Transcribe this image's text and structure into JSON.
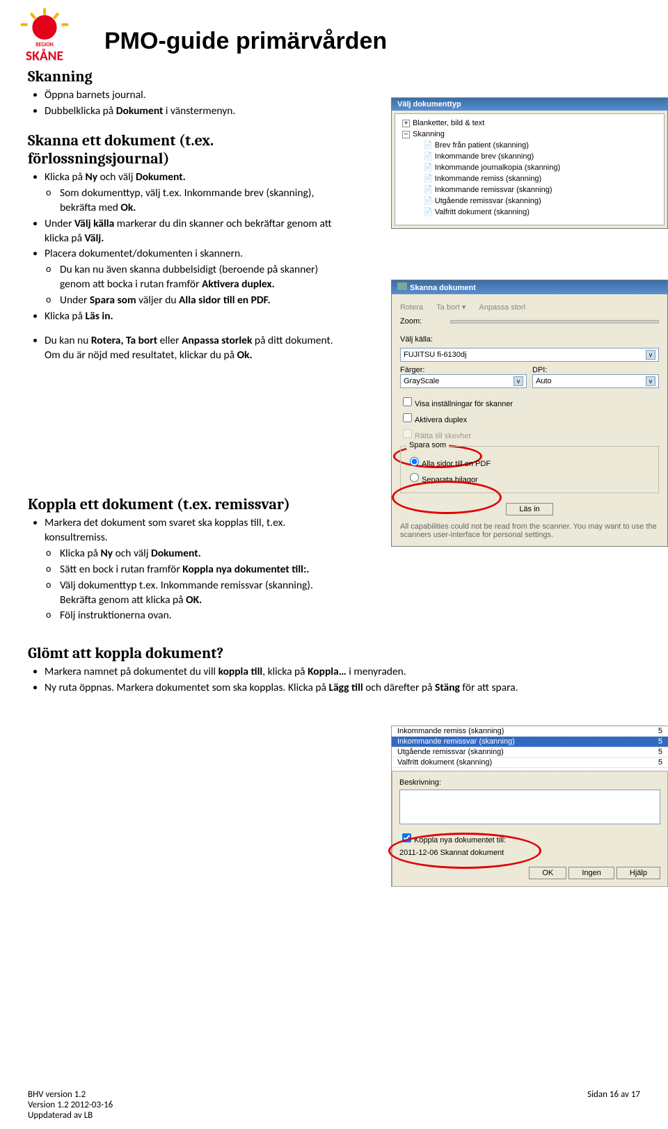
{
  "header": {
    "title": "PMO-guide primärvården",
    "brand_top": "REGION",
    "brand": "SKÅNE"
  },
  "s1": {
    "title": "Skanning",
    "b_pre": "Öppna barnets journal.",
    "b_dbla": "Dubbelklicka på ",
    "b_dblb": "Dokument",
    "b_dblc": " i vänstermenyn."
  },
  "s2": {
    "title": "Skanna ett dokument (t.ex. förlossningsjournal)",
    "l1a": "Klicka på ",
    "l1b": "Ny",
    "l1c": " och välj ",
    "l1d": "Dokument.",
    "o1a": "Som dokumenttyp, välj t.ex. Inkommande brev (skanning), bekräfta med ",
    "o1b": "Ok.",
    "l2a": "Under ",
    "l2b": "Välj källa",
    "l2c": " markerar du din skanner och bekräftar genom att klicka på ",
    "l2d": "Välj.",
    "l3": "Placera dokumentet/dokumenten i skannern.",
    "o2a": "Du kan nu även skanna dubbelsidigt (beroende på skanner) genom att bocka i rutan framför ",
    "o2b": "Aktivera duplex.",
    "o3a": "Under ",
    "o3b": "Spara som",
    "o3c": " väljer du ",
    "o3d": "Alla sidor till en PDF.",
    "l4a": "Klicka på ",
    "l4b": "Läs in.",
    "l5a": "Du kan nu ",
    "l5b": "Rotera, Ta bort",
    "l5c": " eller ",
    "l5d": "Anpassa storlek",
    "l5e": " på ditt dokument. Om du är nöjd med resultatet, klickar du på ",
    "l5f": "Ok."
  },
  "s3": {
    "title": "Koppla ett dokument (t.ex. remissvar)",
    "l1": "Markera det dokument som svaret ska kopplas till, t.ex. konsultremiss.",
    "o1a": "Klicka på ",
    "o1b": "Ny",
    "o1c": " och välj ",
    "o1d": "Dokument.",
    "o2a": "Sätt en bock i rutan framför ",
    "o2b": "Koppla nya dokumentet till:.",
    "o3a": "Välj dokumenttyp t.ex. Inkommande remissvar (skanning). Bekräfta genom att klicka på ",
    "o3b": "OK.",
    "o4": "Följ instruktionerna ovan."
  },
  "s4": {
    "title": "Glömt att koppla dokument?",
    "l1a": "Markera namnet på dokumentet du vill ",
    "l1b": "koppla till",
    "l1c": ", klicka på ",
    "l1d": "Koppla…",
    "l1e": " i menyraden.",
    "l2a": "Ny ruta öppnas. Markera dokumentet som ska kopplas. Klicka på ",
    "l2b": "Lägg till",
    "l2c": " och därefter på ",
    "l2d": "Stäng",
    "l2e": " för att spara."
  },
  "panel1": {
    "title": "Välj dokumenttyp",
    "root1": "Blanketter, bild & text",
    "root2": "Skanning",
    "items": [
      "Brev från patient (skanning)",
      "Inkommande brev (skanning)",
      "Inkommande journalkopia (skanning)",
      "Inkommande remiss (skanning)",
      "Inkommande remissvar (skanning)",
      "Utgående remissvar (skanning)",
      "Valfritt dokument (skanning)"
    ]
  },
  "panel2": {
    "title": "Skanna dokument",
    "tab_rotera": "Rotera",
    "tab_tabort": "Ta bort",
    "tab_anpassa": "Anpassa storl",
    "zoom": "Zoom:",
    "kalla_lbl": "Välj källa:",
    "kalla_val": "FUJITSU fi-6130dj",
    "farger_lbl": "Färger:",
    "farger_val": "GrayScale",
    "dpi_lbl": "DPI:",
    "dpi_val": "Auto",
    "visa": "Visa inställningar för skanner",
    "aktivera": "Aktivera duplex",
    "ratta": "Rätta till skevhet",
    "spara": "Spara som",
    "r1": "Alla sidor till en PDF",
    "r2": "Separata bilagor",
    "lasin": "Läs in",
    "info": "All capabilities could not be read from the scanner. You may want to use the scanners user-interface for personal settings."
  },
  "panel3": {
    "list": [
      {
        "t": "Inkommande remiss (skanning)",
        "n": "5"
      },
      {
        "t": "Inkommande remissvar (skanning)",
        "n": "5",
        "sel": true
      },
      {
        "t": "Utgående remissvar (skanning)",
        "n": "5"
      },
      {
        "t": "Valfritt dokument (skanning)",
        "n": "5"
      }
    ],
    "beskr": "Beskrivning:",
    "koppla": "Koppla nya dokumentet till:",
    "koppla_val": "2011-12-06 Skannat dokument",
    "ok": "OK",
    "ingen": "Ingen",
    "hjalp": "Hjälp"
  },
  "footer": {
    "l1": "BHV version 1.2",
    "l2": "Version 1.2 2012-03-16",
    "l3": "Uppdaterad av LB",
    "r": "Sidan 16 av 17"
  }
}
